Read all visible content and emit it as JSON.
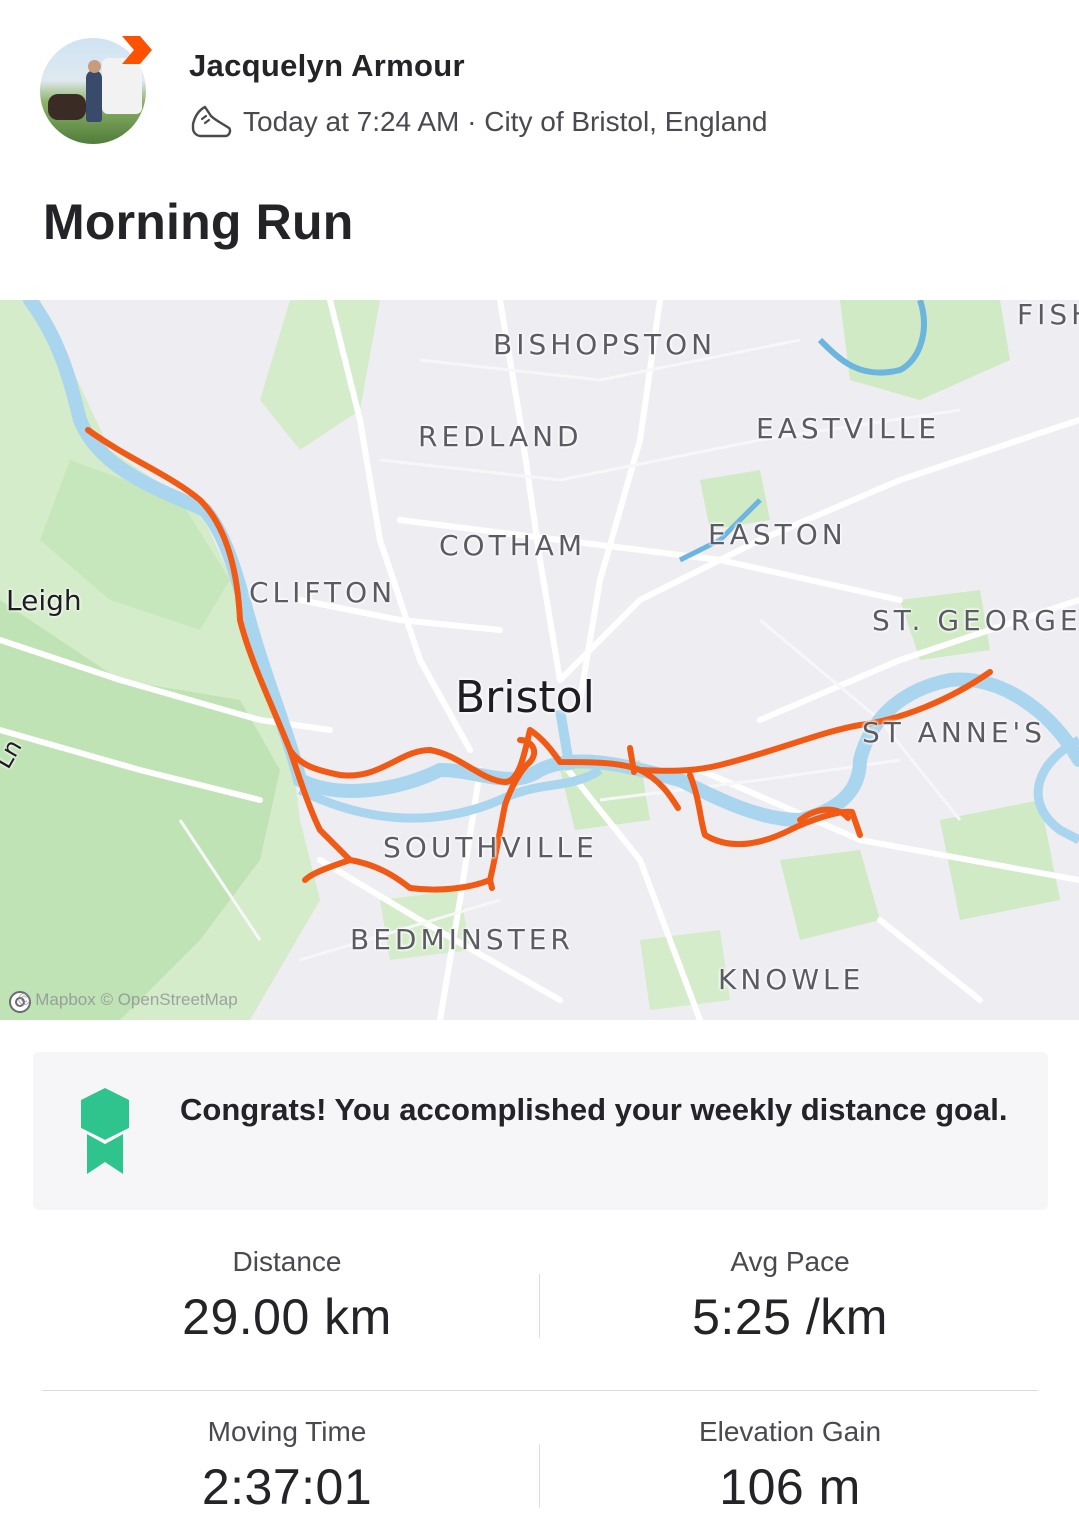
{
  "athlete": {
    "name": "Jacquelyn Armour",
    "activity_icon": "shoe-icon",
    "meta": "Today at 7:24 AM · City of Bristol, England"
  },
  "activity": {
    "title": "Morning Run"
  },
  "map": {
    "city": "Bristol",
    "areas": [
      "BISHOPSTON",
      "REDLAND",
      "EASTVILLE",
      "COTHAM",
      "EASTON",
      "CLIFTON",
      "ST. GEORGE",
      "ST ANNE'S",
      "SOUTHVILLE",
      "BEDMINSTER",
      "KNOWLE",
      "FISH"
    ],
    "places": [
      "Leigh",
      "Ln"
    ],
    "attribution": "© Mapbox © OpenStreetMap",
    "route_color": "#f05a14",
    "water_color": "#a9d6ee",
    "park_color": "#bfe3b4"
  },
  "congrats": {
    "icon": "medal-icon",
    "text": "Congrats! You accomplished your weekly distance goal.",
    "accent_color": "#2fc38e"
  },
  "stats": {
    "distance": {
      "label": "Distance",
      "value": "29.00 km"
    },
    "pace": {
      "label": "Avg Pace",
      "value": "5:25 /km"
    },
    "moving_time": {
      "label": "Moving Time",
      "value": "2:37:01"
    },
    "elevation": {
      "label": "Elevation Gain",
      "value": "106 m"
    }
  }
}
